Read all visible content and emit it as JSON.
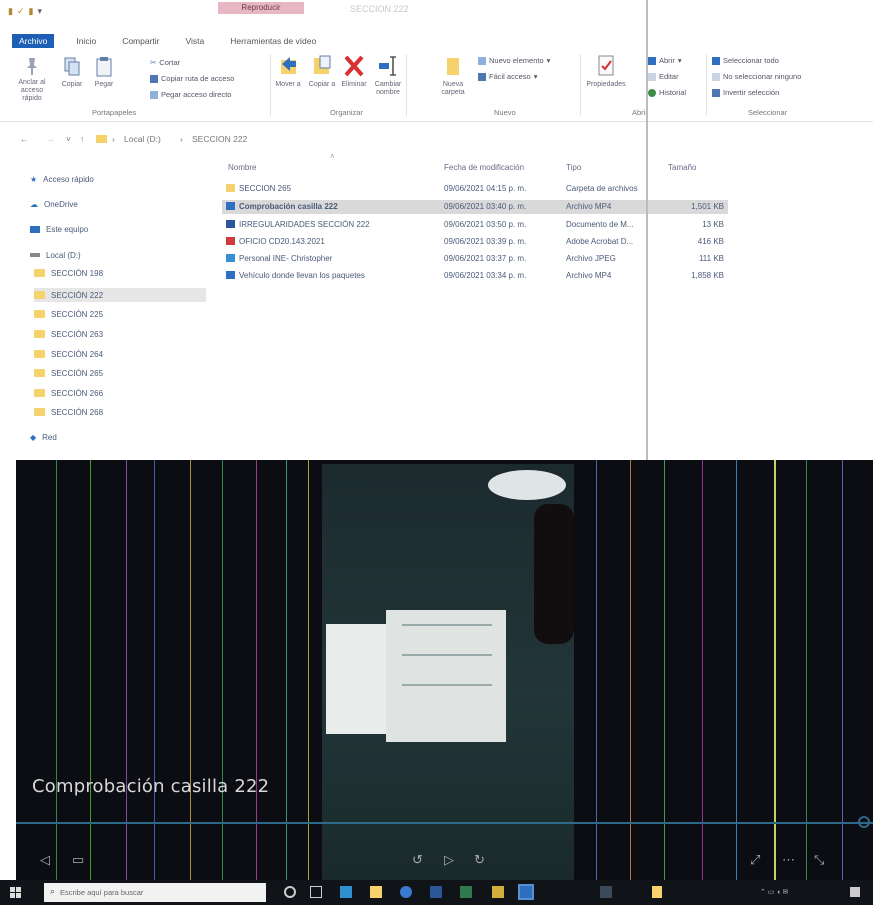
{
  "titlebar": {
    "context_tab": "Reproducir",
    "window_title": "SECCION 222"
  },
  "ribbon_tabs": [
    "Archivo",
    "Inicio",
    "Compartir",
    "Vista",
    "Herramientas de vídeo"
  ],
  "ribbon": {
    "clipboard": {
      "pin": "Anclar al acceso rápido",
      "copy": "Copiar",
      "paste": "Pegar",
      "cut": "Cortar",
      "copy_path": "Copiar ruta de acceso",
      "paste_shortcut": "Pegar acceso directo",
      "group": "Portapapeles"
    },
    "organize": {
      "move": "Mover a",
      "copy_to": "Copiar a",
      "delete": "Eliminar",
      "rename": "Cambiar nombre",
      "group": "Organizar"
    },
    "new": {
      "new_folder": "Nueva carpeta",
      "new_item": "Nuevo elemento",
      "easy_access": "Fácil acceso",
      "group": "Nuevo"
    },
    "open": {
      "properties": "Propiedades",
      "open": "Abrir",
      "edit": "Editar",
      "history": "Historial",
      "group": "Abrir"
    },
    "select": {
      "select_all": "Seleccionar todo",
      "select_none": "No seleccionar ninguno",
      "invert": "Invertir selección",
      "group": "Seleccionar"
    }
  },
  "address": {
    "path": [
      "Local (D:)",
      "SECCION 222"
    ]
  },
  "nav": {
    "quick_access": "Acceso rápido",
    "onedrive": "OneDrive",
    "this_pc": "Este equipo",
    "drive": "Local (D:)",
    "folders": [
      "SECCIÓN 198",
      "SECCIÓN 222",
      "SECCIÓN 225",
      "SECCIÓN 263",
      "SECCIÓN 264",
      "SECCIÓN 265",
      "SECCIÓN 266",
      "SECCIÓN 268"
    ],
    "network": "Red"
  },
  "columns": {
    "name": "Nombre",
    "date": "Fecha de modificación",
    "type": "Tipo",
    "size": "Tamaño"
  },
  "files": [
    {
      "name": "SECCION 265",
      "date": "09/06/2021 04:15 p. m.",
      "type": "Carpeta de archivos",
      "size": "",
      "icon": "folder-icon",
      "color": "#f5d26b"
    },
    {
      "name": "Comprobación casilla 222",
      "date": "09/06/2021 03:40 p. m.",
      "type": "Archivo MP4",
      "size": "1,501 KB",
      "icon": "video-icon",
      "color": "#2f6fbf"
    },
    {
      "name": "IRREGULARIDADES SECCIÓN 222",
      "date": "09/06/2021 03:50 p. m.",
      "type": "Documento de M...",
      "size": "13 KB",
      "icon": "word-icon",
      "color": "#2b579a"
    },
    {
      "name": "OFICIO CD20.143.2021",
      "date": "09/06/2021 03:39 p. m.",
      "type": "Adobe Acrobat D...",
      "size": "416 KB",
      "icon": "pdf-icon",
      "color": "#d03a3a"
    },
    {
      "name": "Personal INE- Christopher",
      "date": "09/06/2021 03:37 p. m.",
      "type": "Archivo JPEG",
      "size": "111 KB",
      "icon": "image-icon",
      "color": "#3a8fd0"
    },
    {
      "name": "Vehículo donde llevan los paquetes",
      "date": "09/06/2021 03:34 p. m.",
      "type": "Archivo MP4",
      "size": "1,858 KB",
      "icon": "video-icon",
      "color": "#2f6fbf"
    }
  ],
  "video": {
    "caption": "Comprobación casilla 222"
  },
  "taskbar": {
    "search_placeholder": "Escribe aquí para buscar"
  }
}
